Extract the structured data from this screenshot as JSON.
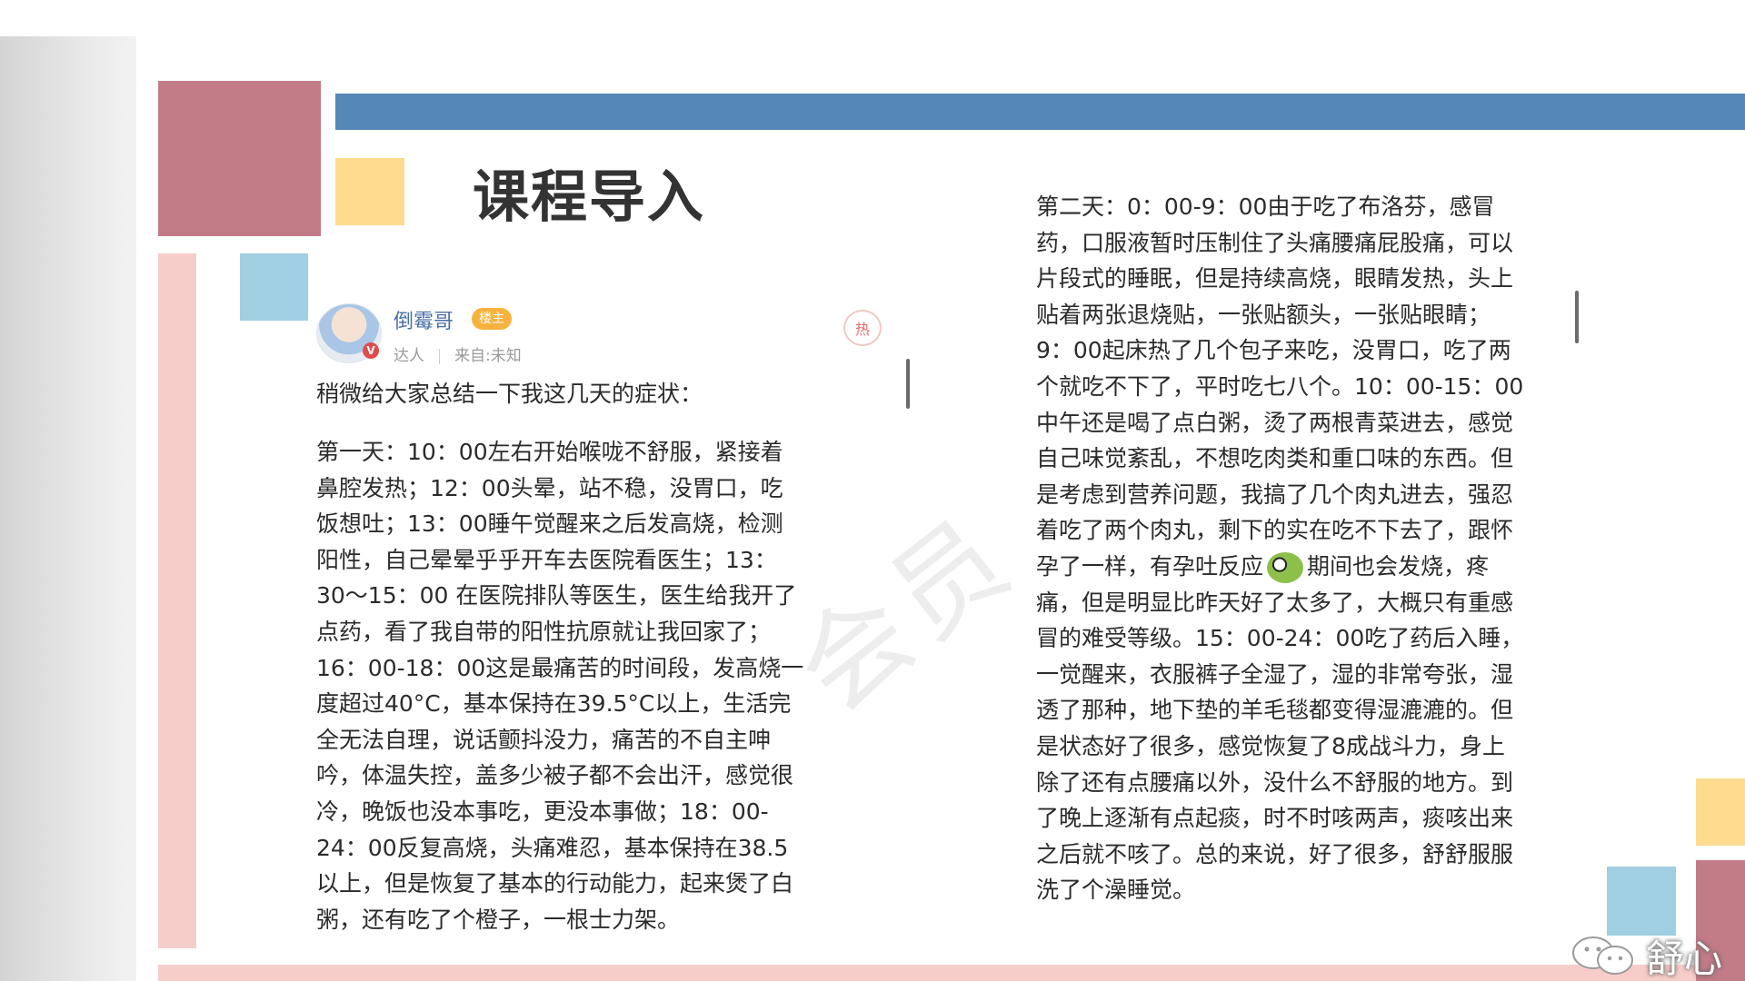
{
  "slide": {
    "title": "课程导入"
  },
  "post": {
    "username": "倒霉哥",
    "owner_tag": "楼主",
    "user_level": "达人",
    "source": "来自:未知",
    "hot_label": "热",
    "avatar_badge": "V",
    "intro": "稍微给大家总结一下我这几天的症状：",
    "left_lines": [
      "第一天：10：00左右开始喉咙不舒服，紧接着",
      "鼻腔发热；12：00头晕，站不稳，没胃口，吃",
      "饭想吐；13：00睡午觉醒来之后发高烧，检测",
      "阳性，自己晕晕乎乎开车去医院看医生；13：",
      "30～15：00 在医院排队等医生，医生给我开了",
      "点药，看了我自带的阳性抗原就让我回家了；",
      "16：00-18：00这是最痛苦的时间段，发高烧一",
      "度超过40°C，基本保持在39.5°C以上，生活完",
      "全无法自理，说话颤抖没力，痛苦的不自主呻",
      "吟，体温失控，盖多少被子都不会出汗，感觉很",
      "冷，晚饭也没本事吃，更没本事做；18：00-",
      "24：00反复高烧，头痛难忍，基本保持在38.5",
      "以上，但是恢复了基本的行动能力，起来煲了白",
      "粥，还有吃了个橙子，一根士力架。"
    ],
    "right_lines": [
      "第二天：0：00-9：00由于吃了布洛芬，感冒",
      "药，口服液暂时压制住了头痛腰痛屁股痛，可以",
      "片段式的睡眠，但是持续高烧，眼睛发热，头上",
      "贴着两张退烧贴，一张贴额头，一张贴眼睛；",
      "9：00起床热了几个包子来吃，没胃口，吃了两",
      "个就吃不下了，平时吃七八个。10：00-15：00",
      "中午还是喝了点白粥，烫了两根青菜进去，感觉",
      "自己味觉紊乱，不想吃肉类和重口味的东西。但",
      "是考虑到营养问题，我搞了几个肉丸进去，强忍",
      "着吃了两个肉丸，剩下的实在吃不下去了，跟怀"
    ],
    "right_emoji_line_before": "孕了一样，有孕吐反应",
    "right_emoji_line_after": "期间也会发烧，疼",
    "right_lines_2": [
      "痛，但是明显比昨天好了太多了，大概只有重感",
      "冒的难受等级。15：00-24：00吃了药后入睡，",
      "一觉醒来，衣服裤子全湿了，湿的非常夸张，湿",
      "透了那种，地下垫的羊毛毯都变得湿漉漉的。但",
      "是状态好了很多，感觉恢复了8成战斗力，身上",
      "除了还有点腰痛以外，没什么不舒服的地方。到",
      "了晚上逐渐有点起痰，时不时咳两声，痰咳出来",
      "之后就不咳了。总的来说，好了很多，舒舒服服",
      "洗了个澡睡觉。"
    ]
  },
  "watermark": "会员",
  "brand": {
    "name": "舒心"
  },
  "colors": {
    "accent_blue": "#5588b4",
    "accent_rose": "#c27c88",
    "accent_yellow": "#fedb8f",
    "accent_lightblue": "#9fcfe0",
    "accent_pink": "#f7cdca"
  }
}
